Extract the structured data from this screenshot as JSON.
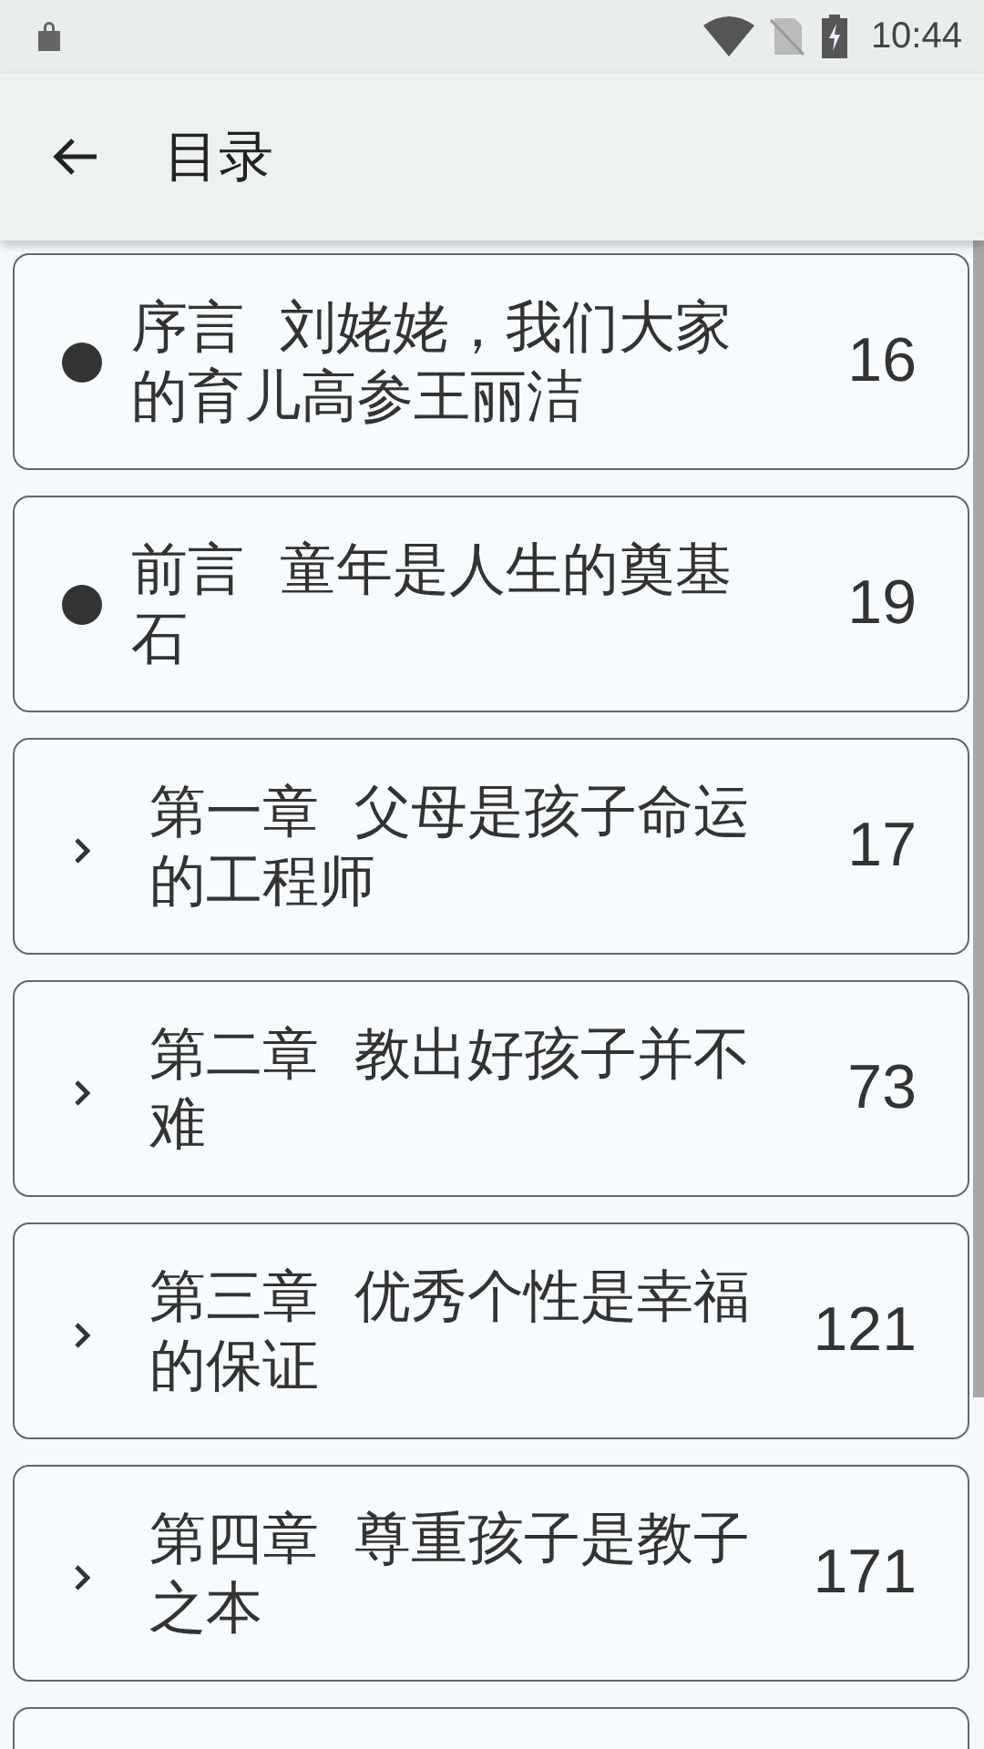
{
  "status_bar": {
    "time": "10:44"
  },
  "app_bar": {
    "title": "目录"
  },
  "chapters": [
    {
      "kind": "section",
      "title": "序言  刘姥姥，我们大家的育儿高参王丽洁",
      "page": "16"
    },
    {
      "kind": "section",
      "title": "前言  童年是人生的奠基石",
      "page": "19"
    },
    {
      "kind": "chapter",
      "title": "第一章  父母是孩子命运的工程师",
      "page": "17"
    },
    {
      "kind": "chapter",
      "title": "第二章  教出好孩子并不难",
      "page": "73"
    },
    {
      "kind": "chapter",
      "title": "第三章  优秀个性是幸福的保证",
      "page": "121"
    },
    {
      "kind": "chapter",
      "title": "第四章  尊重孩子是教子之本",
      "page": "171"
    }
  ]
}
